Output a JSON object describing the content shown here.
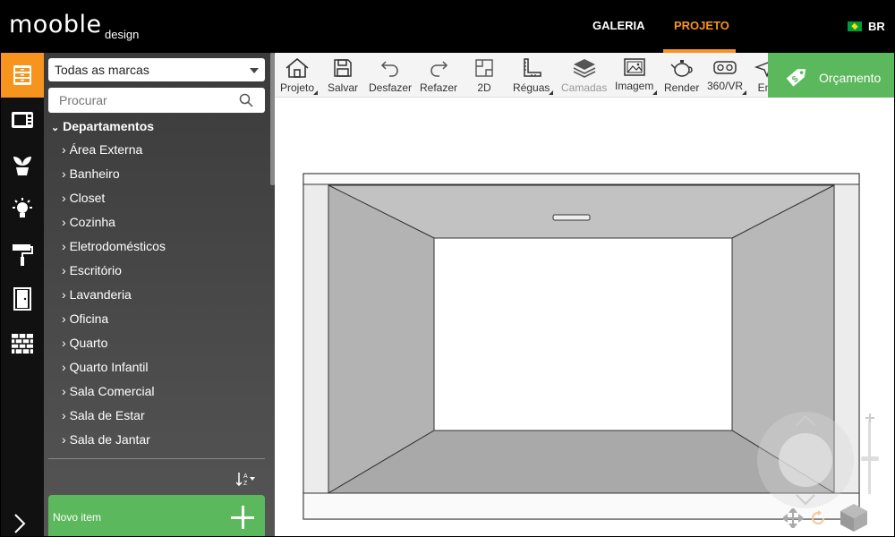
{
  "header": {
    "logo": "mooble",
    "logo_sub": "design",
    "nav": [
      {
        "label": "GALERIA"
      },
      {
        "label": "PROJETO",
        "active": true
      }
    ],
    "language": "BR",
    "accent_color": "#f7941d"
  },
  "rail": {
    "items": [
      {
        "icon": "cabinet-icon",
        "active": true
      },
      {
        "icon": "microwave-icon"
      },
      {
        "icon": "plant-icon"
      },
      {
        "icon": "lamp-icon"
      },
      {
        "icon": "paint-roller-icon"
      },
      {
        "icon": "door-icon"
      },
      {
        "icon": "brick-wall-icon"
      }
    ],
    "expand_icon": "chevron-right-icon"
  },
  "sidebar": {
    "brand_select": "Todas as marcas",
    "search_placeholder": "Procurar",
    "departments_title": "Departamentos",
    "departments": [
      "Área Externa",
      "Banheiro",
      "Closet",
      "Cozinha",
      "Eletrodomésticos",
      "Escritório",
      "Lavanderia",
      "Oficina",
      "Quarto",
      "Quarto Infantil",
      "Sala Comercial",
      "Sala de Estar",
      "Sala de Jantar"
    ],
    "new_item": "Novo item",
    "new_item_color": "#5cb85c"
  },
  "toolbar": {
    "tools": [
      {
        "label": "Projeto",
        "icon": "house-icon",
        "menu": true
      },
      {
        "label": "Salvar",
        "icon": "floppy-icon"
      },
      {
        "label": "Desfazer",
        "icon": "undo-icon"
      },
      {
        "label": "Refazer",
        "icon": "redo-icon"
      },
      {
        "label": "2D",
        "icon": "plan-2d-icon"
      },
      {
        "label": "Réguas",
        "icon": "ruler-icon",
        "menu": true
      },
      {
        "label": "Camadas",
        "icon": "layers-icon",
        "disabled": true
      },
      {
        "label": "Imagem",
        "icon": "image-icon",
        "menu": true
      },
      {
        "label": "Render",
        "icon": "teapot-icon"
      },
      {
        "label": "360/VR",
        "icon": "vr-icon",
        "menu": true
      },
      {
        "label": "En",
        "icon": "send-icon"
      }
    ],
    "quote_button": "Orçamento"
  }
}
